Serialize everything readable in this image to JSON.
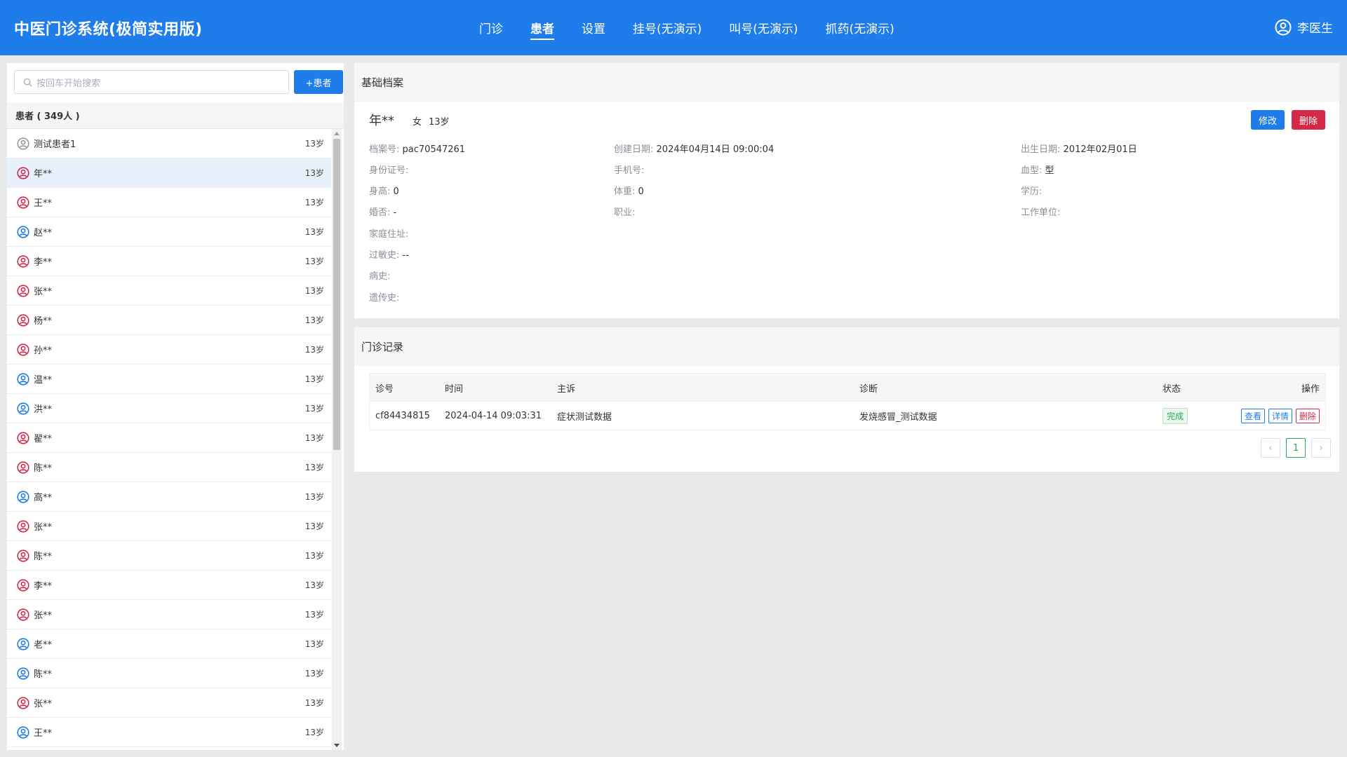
{
  "header": {
    "brand": "中医门诊系统(极简实用版)",
    "nav": [
      {
        "label": "门诊",
        "active": false
      },
      {
        "label": "患者",
        "active": true
      },
      {
        "label": "设置",
        "active": false
      },
      {
        "label": "挂号(无演示)",
        "active": false
      },
      {
        "label": "叫号(无演示)",
        "active": false
      },
      {
        "label": "抓药(无演示)",
        "active": false
      }
    ],
    "user_name": "李医生"
  },
  "sidebar": {
    "search_placeholder": "按回车开始搜索",
    "add_label": "+患者",
    "list_title": "患者 ( 349人 )",
    "patients": [
      {
        "name": "测试患者1",
        "age": "13岁",
        "gender": "unknown",
        "selected": false
      },
      {
        "name": "年**",
        "age": "13岁",
        "gender": "female",
        "selected": true
      },
      {
        "name": "王**",
        "age": "13岁",
        "gender": "female",
        "selected": false
      },
      {
        "name": "赵**",
        "age": "13岁",
        "gender": "male",
        "selected": false
      },
      {
        "name": "李**",
        "age": "13岁",
        "gender": "female",
        "selected": false
      },
      {
        "name": "张**",
        "age": "13岁",
        "gender": "female",
        "selected": false
      },
      {
        "name": "杨**",
        "age": "13岁",
        "gender": "female",
        "selected": false
      },
      {
        "name": "孙**",
        "age": "13岁",
        "gender": "female",
        "selected": false
      },
      {
        "name": "温**",
        "age": "13岁",
        "gender": "male",
        "selected": false
      },
      {
        "name": "洪**",
        "age": "13岁",
        "gender": "male",
        "selected": false
      },
      {
        "name": "翟**",
        "age": "13岁",
        "gender": "female",
        "selected": false
      },
      {
        "name": "陈**",
        "age": "13岁",
        "gender": "female",
        "selected": false
      },
      {
        "name": "高**",
        "age": "13岁",
        "gender": "male",
        "selected": false
      },
      {
        "name": "张**",
        "age": "13岁",
        "gender": "female",
        "selected": false
      },
      {
        "name": "陈**",
        "age": "13岁",
        "gender": "female",
        "selected": false
      },
      {
        "name": "李**",
        "age": "13岁",
        "gender": "female",
        "selected": false
      },
      {
        "name": "张**",
        "age": "13岁",
        "gender": "female",
        "selected": false
      },
      {
        "name": "老**",
        "age": "13岁",
        "gender": "male",
        "selected": false
      },
      {
        "name": "陈**",
        "age": "13岁",
        "gender": "male",
        "selected": false
      },
      {
        "name": "张**",
        "age": "13岁",
        "gender": "female",
        "selected": false
      },
      {
        "name": "王**",
        "age": "13岁",
        "gender": "male",
        "selected": false
      }
    ]
  },
  "profile": {
    "title": "基础档案",
    "name": "年**",
    "sex": "女",
    "age": "13岁",
    "edit_label": "修改",
    "delete_label": "删除",
    "fields": {
      "file_no_label": "档案号:",
      "file_no": "pac70547261",
      "created_label": "创建日期:",
      "created": "2024年04月14日 09:00:04",
      "birth_label": "出生日期:",
      "birth": "2012年02月01日",
      "id_label": "身份证号:",
      "id": "",
      "phone_label": "手机号:",
      "phone": "",
      "blood_label": "血型:",
      "blood": "型",
      "height_label": "身高:",
      "height": "0",
      "weight_label": "体重:",
      "weight": "0",
      "edu_label": "学历:",
      "edu": "",
      "marital_label": "婚否:",
      "marital": "-",
      "job_label": "职业:",
      "job": "",
      "work_label": "工作单位:",
      "work": "",
      "address_label": "家庭住址:",
      "address": "",
      "allergy_label": "过敏史:",
      "allergy": "--",
      "history_label": "病史:",
      "history": "",
      "genetic_label": "遗传史:",
      "genetic": ""
    }
  },
  "records": {
    "title": "门诊记录",
    "columns": {
      "no": "诊号",
      "time": "时间",
      "complaint": "主诉",
      "diagnosis": "诊断",
      "status": "状态",
      "ops": "操作"
    },
    "rows": [
      {
        "no": "cf84434815",
        "time": "2024-04-14 09:03:31",
        "complaint": "症状测试数据",
        "diagnosis": "发烧感冒_测试数据",
        "status": "完成",
        "view": "查看",
        "detail": "详情",
        "delete": "删除"
      }
    ],
    "pager": {
      "prev": "‹",
      "current": "1",
      "next": "›"
    }
  },
  "colors": {
    "primary": "#1f7ceb",
    "danger": "#d6294a",
    "success": "#27a85a",
    "female_icon": "#d6294a",
    "male_icon": "#1f7ceb",
    "unknown_icon": "#999999"
  }
}
